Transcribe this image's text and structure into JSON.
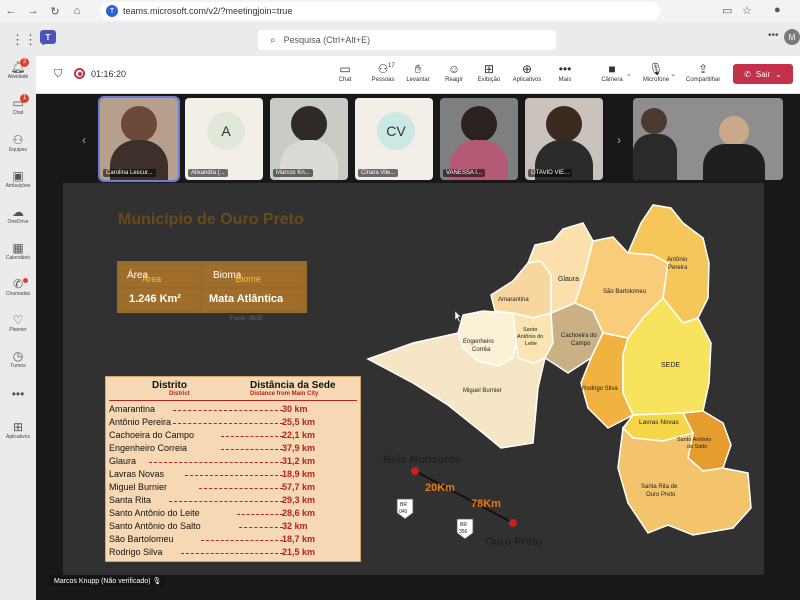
{
  "browser": {
    "url": "teams.microsoft.com/v2/?meetingjoin=true",
    "url_icon": "T"
  },
  "teams": {
    "search_placeholder": "Pesquisa (Ctrl+Alt+E)",
    "avatar_initial": "M",
    "logo": "T"
  },
  "rail": [
    {
      "label": "Atividade",
      "icon": "bell-icon",
      "badge": "2"
    },
    {
      "label": "Chat",
      "icon": "chat-icon",
      "badge": "1"
    },
    {
      "label": "Equipes",
      "icon": "team-icon"
    },
    {
      "label": "Atribuições",
      "icon": "backpack-icon"
    },
    {
      "label": "OneDrive",
      "icon": "cloud-icon"
    },
    {
      "label": "Calendário",
      "icon": "calendar-icon"
    },
    {
      "label": "Chamadas",
      "icon": "phone-icon",
      "dot": true
    },
    {
      "label": "Planner",
      "icon": "planner-icon"
    },
    {
      "label": "Turnos",
      "icon": "clock-icon"
    },
    {
      "label": "",
      "icon": "more-icon"
    },
    {
      "label": "Aplicativos",
      "icon": "apps-icon"
    }
  ],
  "meeting": {
    "timer": "01:16:20",
    "controls": [
      {
        "label": "Chat",
        "icon": "chat-icon"
      },
      {
        "label": "Pessoas",
        "icon": "people-icon",
        "count": "17"
      },
      {
        "label": "Levantar",
        "icon": "hand-icon"
      },
      {
        "label": "Reagir",
        "icon": "smile-icon"
      },
      {
        "label": "Exibição",
        "icon": "layout-icon"
      },
      {
        "label": "Aplicativos",
        "icon": "plus-icon"
      },
      {
        "label": "Mais",
        "icon": "more-icon"
      },
      {
        "label": "Câmera",
        "icon": "camera-icon"
      },
      {
        "label": "Microfone",
        "icon": "mic-off-icon"
      },
      {
        "label": "Compartilhar",
        "icon": "share-icon"
      }
    ],
    "leave_label": "Sair",
    "participants": [
      {
        "name": "Carolina Lescur...",
        "type": "video"
      },
      {
        "name": "Alixandra (...",
        "type": "initial",
        "initial": "A",
        "color": "#dfe8d9"
      },
      {
        "name": "Marcos Kn...",
        "type": "video"
      },
      {
        "name": "Cinara Vile...",
        "type": "initial",
        "initial": "CV",
        "color": "#cbe9e4"
      },
      {
        "name": "VANESSA I...",
        "type": "video"
      },
      {
        "name": "OTAVIO VIE...",
        "type": "video"
      }
    ],
    "presenter_caption": "Marcos Knupp (Não verificado)"
  },
  "slide": {
    "title": "Município de Ouro Preto",
    "area_label": "Área",
    "area_sub": "Area",
    "area_value": "1.246 Km²",
    "bioma_label": "Bioma",
    "bioma_sub": "Biome",
    "bioma_value": "Mata Atlântica",
    "source": "Fonte: IBGE",
    "table_h1": "Distrito",
    "table_h1_sub": "District",
    "table_h2": "Distância da Sede",
    "table_h2_sub": "Distance from Main City",
    "districts": [
      {
        "name": "Amarantina",
        "distance": "30 km"
      },
      {
        "name": "Antônio Pereira",
        "distance": "25,5 km"
      },
      {
        "name": "Cachoeira do Campo",
        "distance": "22,1 km"
      },
      {
        "name": "Engenheiro Correia",
        "distance": "37,9 km"
      },
      {
        "name": "Glaura",
        "distance": "31,2 km"
      },
      {
        "name": "Lavras Novas",
        "distance": "18,9 km"
      },
      {
        "name": "Miguel Burnier",
        "distance": "57,7 km"
      },
      {
        "name": "Santa Rita",
        "distance": "29,3 km"
      },
      {
        "name": "Santo Antônio do Leite",
        "distance": "28,6 km"
      },
      {
        "name": "Santo Antônio do Salto",
        "distance": "32 km"
      },
      {
        "name": "São Bartolomeu",
        "distance": "18,7 km"
      },
      {
        "name": "Rodrigo Silva",
        "distance": "21,5 km"
      }
    ],
    "map_labels": {
      "glaura": "Glaura",
      "antonio_pereira_1": "Antônio",
      "antonio_pereira_2": "Pereira",
      "amarantina": "Amarantina",
      "sao_bartolomeu": "São Bartolomeu",
      "santo_antonio_leite_1": "Santo",
      "santo_antonio_leite_2": "Antônio do",
      "santo_antonio_leite_3": "Leite",
      "cachoeira_1": "Cachoeira do",
      "cachoeira_2": "Campo",
      "engenheiro_1": "Engenheiro",
      "engenheiro_2": "Corrêa",
      "sede": "SEDE",
      "rodrigo_silva": "Rodrigo Silva",
      "miguel_burnier": "Miguel Burnier",
      "lavras_novas": "Lavras Novas",
      "santo_antonio_salto_1": "Santo Antônio",
      "santo_antonio_salto_2": "do Salto",
      "santa_rita_1": "Santa Rita de",
      "santa_rita_2": "Ouro Preto"
    },
    "route": {
      "from": "Belo Horizonte",
      "to": "Ouro Preto",
      "dist1": "20Km",
      "dist2": "78Km",
      "shield1_top": "BR",
      "shield1_bottom": "040",
      "shield2_top": "BR",
      "shield2_bottom": "356"
    }
  }
}
